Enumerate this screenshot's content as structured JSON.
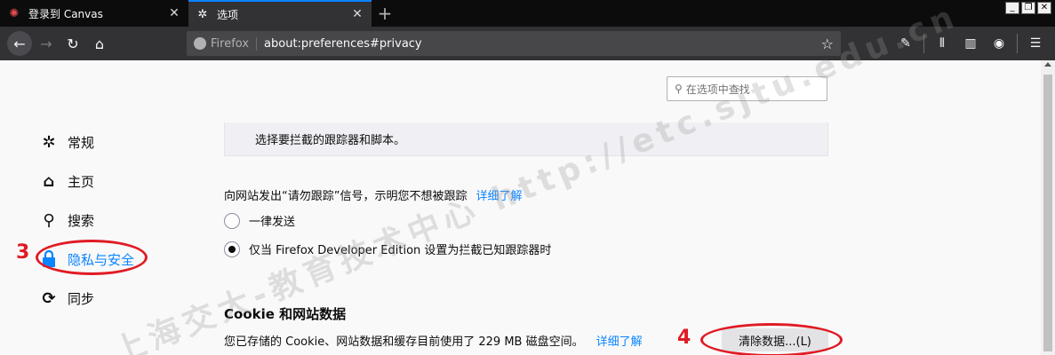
{
  "tabs": [
    {
      "title": "登录到 Canvas",
      "favicon": "canvas-logo-icon",
      "active": false
    },
    {
      "title": "选项",
      "favicon": "gear-icon",
      "active": true
    }
  ],
  "window_controls": {
    "minimize": "_",
    "restore": "❐",
    "close": "✕"
  },
  "urlbar": {
    "identity_label": "Firefox",
    "url": "about:preferences#privacy"
  },
  "search": {
    "placeholder": "在选项中查找"
  },
  "sidebar": {
    "items": [
      {
        "label": "常规",
        "icon": "gear-icon"
      },
      {
        "label": "主页",
        "icon": "home-icon"
      },
      {
        "label": "搜索",
        "icon": "search-icon"
      },
      {
        "label": "隐私与安全",
        "icon": "lock-icon",
        "selected": true
      },
      {
        "label": "同步",
        "icon": "sync-icon"
      }
    ]
  },
  "main": {
    "block_text": "选择要拦截的跟踪器和脚本。",
    "dnt_text": "向网站发出“请勿跟踪”信号，示明您不想被跟踪",
    "dnt_link": "详细了解",
    "radio_always": "一律发送",
    "radio_only": "仅当 Firefox Developer Edition 设置为拦截已知跟踪器时",
    "cookie_title": "Cookie 和网站数据",
    "cookie_text": "您已存储的 Cookie、网站数据和缓存目前使用了 229 MB 磁盘空间。",
    "cookie_link": "详细了解",
    "clear_button": "清除数据...(L)"
  },
  "annotations": {
    "num3": "3",
    "num4": "4"
  },
  "watermark": "上海交大-教育技术中心  http://etc.sjtu.edu.cn",
  "colors": {
    "accent": "#0a84ff",
    "annotation": "#e01b24"
  }
}
